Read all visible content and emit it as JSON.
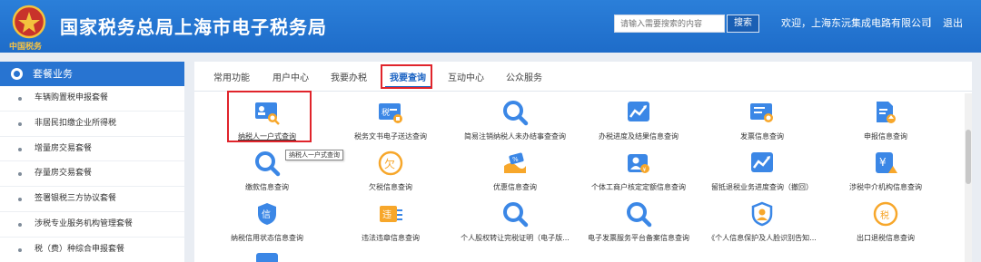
{
  "header": {
    "title": "国家税务总局上海市电子税务局",
    "emblem_caption": "中国税务",
    "search_placeholder": "请输入需要搜索的内容",
    "search_button": "搜索",
    "welcome": "欢迎，上海东沅集成电路有限公司",
    "separator": "|",
    "logout": "退出"
  },
  "sidebar": {
    "title": "套餐业务",
    "items": [
      {
        "label": "车辆购置税申报套餐"
      },
      {
        "label": "非居民扣缴企业所得税"
      },
      {
        "label": "增量房交易套餐"
      },
      {
        "label": "存量房交易套餐"
      },
      {
        "label": "签署银税三方协议套餐"
      },
      {
        "label": "涉税专业服务机构管理套餐"
      },
      {
        "label": "税（费）种综合申报套餐"
      }
    ]
  },
  "tabs": [
    {
      "label": "常用功能"
    },
    {
      "label": "用户中心"
    },
    {
      "label": "我要办税"
    },
    {
      "label": "我要查询",
      "active": true
    },
    {
      "label": "互动中心"
    },
    {
      "label": "公众服务"
    }
  ],
  "tooltip": "纳税人一户式查询",
  "services": [
    {
      "label": "纳税人一户式查询",
      "icon": "id-card-search-icon"
    },
    {
      "label": "税务文书电子送达查询",
      "icon": "tax-document-icon"
    },
    {
      "label": "简易注销纳税人未办结事查查询",
      "icon": "search-icon"
    },
    {
      "label": "办税进度及结果信息查询",
      "icon": "progress-chart-icon"
    },
    {
      "label": "发票信息查询",
      "icon": "invoice-search-icon"
    },
    {
      "label": "申报信息查询",
      "icon": "declaration-upload-icon"
    },
    {
      "label": "缴款信息查询",
      "icon": "search-icon"
    },
    {
      "label": "欠税信息查询",
      "icon": "tax-arrears-icon"
    },
    {
      "label": "优惠信息查询",
      "icon": "discount-icon"
    },
    {
      "label": "个体工商户核定定额信息查询",
      "icon": "person-quota-icon"
    },
    {
      "label": "留抵退税业务进度查询（撤回）",
      "icon": "refund-progress-icon"
    },
    {
      "label": "涉税中介机构信息查询",
      "icon": "agency-yen-icon"
    },
    {
      "label": "纳税信用状态信息查询",
      "icon": "credit-shield-icon"
    },
    {
      "label": "违法违章信息查询",
      "icon": "violation-icon"
    },
    {
      "label": "个人股权转让完税证明（电子版...",
      "icon": "search-icon"
    },
    {
      "label": "电子发票服务平台备案信息查询",
      "icon": "search-icon"
    },
    {
      "label": "《个人信息保护及人脸识别告知...",
      "icon": "face-shield-icon"
    },
    {
      "label": "出口退税信息查询",
      "icon": "export-refund-icon"
    }
  ],
  "colors": {
    "header_blue": "#1e6cc9",
    "accent": "#2f7de1",
    "highlight_red": "#e0242b"
  }
}
